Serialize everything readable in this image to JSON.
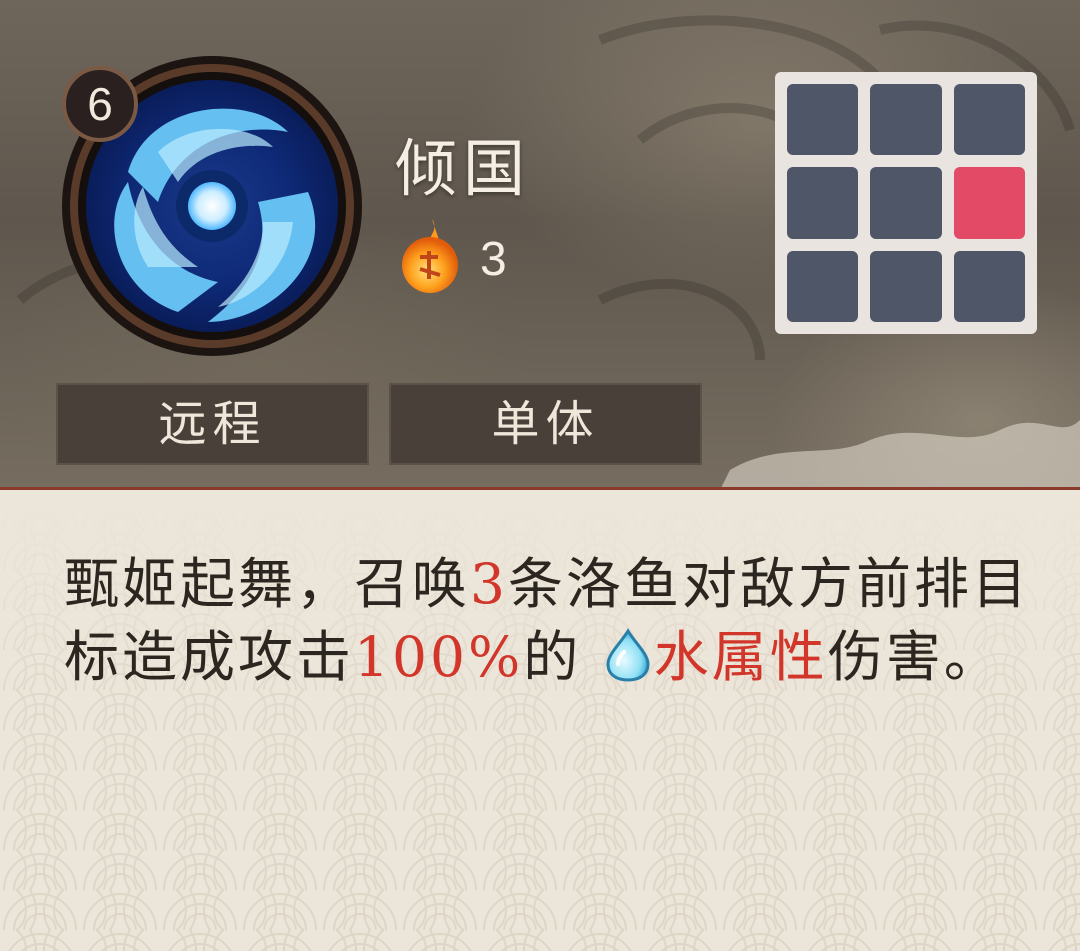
{
  "skill": {
    "level": "6",
    "name": "倾国",
    "cost_icon": "fire-orb-icon",
    "cost": "3",
    "icon": "water-vortex-icon"
  },
  "tags": {
    "range": "远程",
    "target": "单体"
  },
  "attack_grid": {
    "rows": 3,
    "cols": 3,
    "active_cells": [
      [
        1,
        2
      ]
    ],
    "colors": {
      "cell": "#4f5668",
      "active": "#e34a66",
      "background": "#e9e4df"
    }
  },
  "description": {
    "part1": "甄姬起舞，召唤",
    "count": "3",
    "part2": "条洛鱼对敌方前排目标造成攻击",
    "percent": "100%",
    "part3": "的",
    "element_icon": "water-drop-icon",
    "element": "水属性",
    "part4": "伤害。",
    "highlight_color": "#d2362a"
  }
}
